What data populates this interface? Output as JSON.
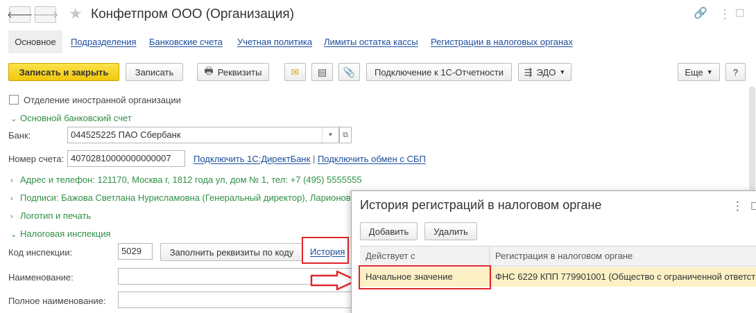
{
  "window": {
    "title": "Конфетпром ООО (Организация)",
    "back_icon": "arrow-left-icon",
    "forward_icon": "arrow-right-icon"
  },
  "tabs": [
    {
      "label": "Основное",
      "active": true
    },
    {
      "label": "Подразделения"
    },
    {
      "label": "Банковские счета"
    },
    {
      "label": "Учетная политика"
    },
    {
      "label": "Лимиты остатка кассы"
    },
    {
      "label": "Регистрации в налоговых органах"
    }
  ],
  "toolbar": {
    "save_close": "Записать и закрыть",
    "save": "Записать",
    "requisites": "Реквизиты",
    "connect_1c": "Подключение к 1С-Отчетности",
    "edo": "ЭДО",
    "more": "Еще",
    "help": "?"
  },
  "form": {
    "foreign_branch": "Отделение иностранной организации",
    "bank_section": "Основной банковский счет",
    "bank_label": "Банк:",
    "bank_value": "044525225 ПАО Сбербанк",
    "account_label": "Номер счета:",
    "account_value": "40702810000000000007",
    "direct_bank_link": "Подключить 1С:ДиректБанк",
    "separator": "|",
    "sbp_link": "Подключить обмен с СБП",
    "address_section": "Адрес и телефон: 121170, Москва г, 1812 года ул, дом № 1, тел: +7 (495) 5555555",
    "signatures_section": "Подписи: Бажова Светлана Нурисламовна (Генеральный директор), Ларионов",
    "logo_section": "Логотип и печать",
    "tax_section": "Налоговая инспекция",
    "inspection_code_label": "Код инспекции:",
    "inspection_code_value": "5029",
    "fill_by_code": "Заполнить реквизиты по коду",
    "history_link": "История",
    "name_label": "Наименование:",
    "full_name_label": "Полное наименование:"
  },
  "dialog": {
    "title": "История регистраций в налоговом органе",
    "add": "Добавить",
    "delete": "Удалить",
    "col_valid_from": "Действует с",
    "col_registration": "Регистрация в налоговом органе",
    "row_valid_from": "Начальное значение",
    "row_registration": "ФНС 6229 КПП 779901001 (Общество с ограниченной ответстве"
  },
  "colors": {
    "accent_yellow": "#f5cc14",
    "link_blue": "#1a4c9c",
    "section_green": "#2f8f45",
    "highlight_red": "#e0262b",
    "selected_row": "#fbf0c6"
  }
}
